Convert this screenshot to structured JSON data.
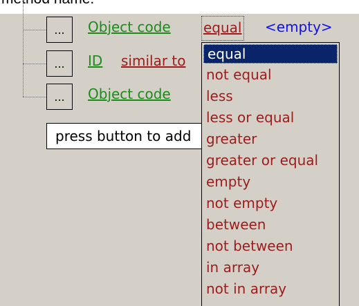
{
  "top_fragment": "method name.",
  "conditions": [
    {
      "field": "Object code"
    },
    {
      "field": "ID",
      "operator": "similar to"
    },
    {
      "field": "Object code"
    }
  ],
  "button_label": "...",
  "current_operator": "equal",
  "current_value": "<empty>",
  "add_button_label": "press button to add",
  "dropdown": {
    "selected_index": 0,
    "options": [
      "equal",
      "not equal",
      "less",
      "less or equal",
      "greater",
      "greater or equal",
      "empty",
      "not empty",
      "between",
      "not between",
      "in array",
      "not in array"
    ]
  },
  "colors": {
    "background": "#d4d0c8",
    "field_link": "#1a8c1a",
    "operator_link": "#9c1c1c",
    "value_link": "#1010ee",
    "selection": "#0a246a"
  }
}
